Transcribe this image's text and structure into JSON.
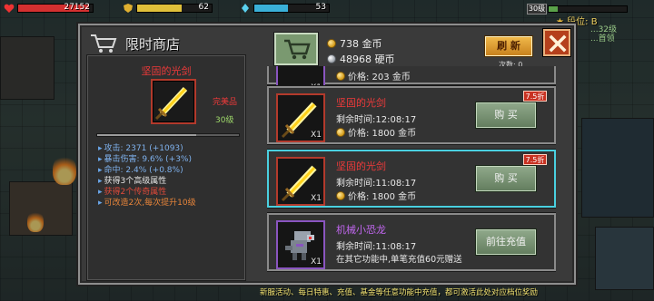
{
  "hud": {
    "hp_value": "27152",
    "energy_value": "62",
    "mana_value": "53",
    "hp_fraction": 0.95,
    "energy_fraction": 0.6,
    "mana_fraction": 0.45,
    "level_label": "30级",
    "rank_label": "段位: B",
    "side_list": [
      "...32级",
      "...首领"
    ]
  },
  "shop": {
    "title": "限时商店",
    "gold_value": "738 金币",
    "coin_value": "48968 硬币",
    "refresh_label": "刷 新",
    "refresh_count": "次数: 0"
  },
  "detail": {
    "name": "坚固的光剑",
    "quality": "完美品",
    "level": "30级",
    "stats": [
      {
        "text": "攻击: 2371 (+1093)",
        "color": "blue"
      },
      {
        "text": "暴击伤害: 9.6% (+3%)",
        "color": "blue"
      },
      {
        "text": "命中: 2.4% (+0.8%)",
        "color": "blue"
      },
      {
        "text": "获得3个高级属性",
        "color": "white"
      },
      {
        "text": "获得2个传奇属性",
        "color": "red"
      },
      {
        "text": "可改造2次,每次提升10级",
        "color": "orange"
      }
    ]
  },
  "items": [
    {
      "name": "",
      "time": "",
      "price": "价格: 203 金币",
      "button": "",
      "discount": "",
      "qty": "X1"
    },
    {
      "name": "坚固的光剑",
      "time": "剩余时间:12:08:17",
      "price": "价格: 1800 金币",
      "button": "购 买",
      "discount": "7.5折",
      "qty": "X1"
    },
    {
      "name": "坚固的光剑",
      "time": "剩余时间:11:08:17",
      "price": "价格: 1800 金币",
      "button": "购 买",
      "discount": "7.5折",
      "qty": "X1"
    },
    {
      "name": "机械小恐龙",
      "time": "剩余时间:11:08:17",
      "price": "在其它功能中,单笔充值60元赠送",
      "button": "前往充值",
      "discount": "",
      "qty": "X1"
    }
  ],
  "notice": "新服活动、每日特惠、充值、基金等任意功能中充值，都可激活此处对应档位奖励",
  "colors": {
    "accent_cyan": "#4ad0e0",
    "legend_red": "#ee3a3a",
    "mythic_purple": "#c066ee",
    "gold": "#f0b84a"
  }
}
